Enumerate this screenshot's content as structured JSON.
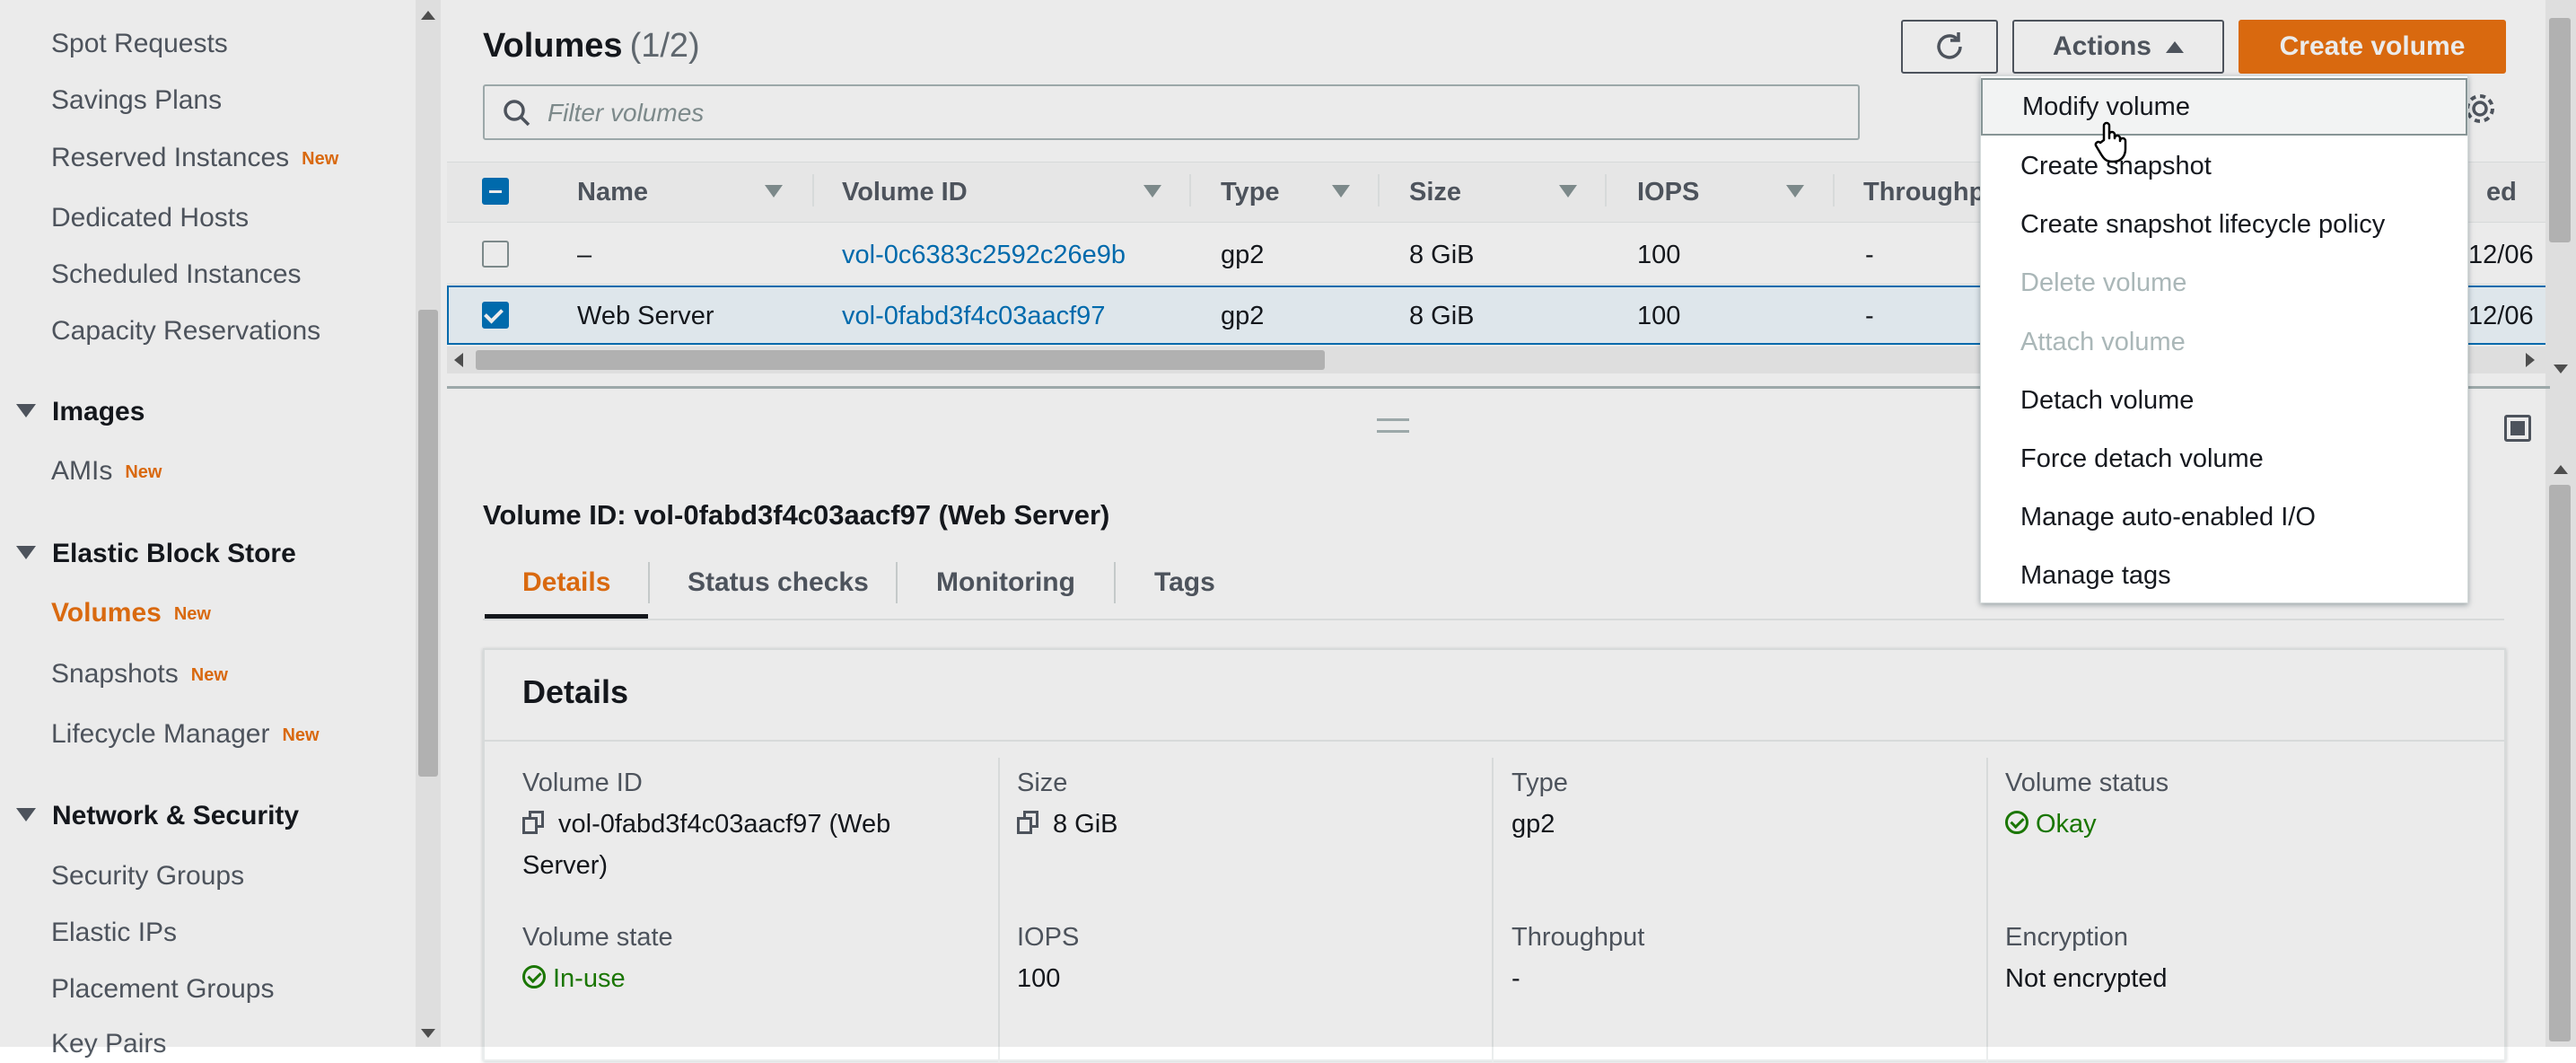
{
  "sidebar": {
    "items": [
      {
        "label": "Spot Requests",
        "badge": ""
      },
      {
        "label": "Savings Plans",
        "badge": ""
      },
      {
        "label": "Reserved Instances",
        "badge": "New"
      },
      {
        "label": "Dedicated Hosts",
        "badge": ""
      },
      {
        "label": "Scheduled Instances",
        "badge": ""
      },
      {
        "label": "Capacity Reservations",
        "badge": ""
      }
    ],
    "sections": {
      "images": {
        "title": "Images",
        "items": [
          {
            "label": "AMIs",
            "badge": "New"
          }
        ]
      },
      "ebs": {
        "title": "Elastic Block Store",
        "items": [
          {
            "label": "Volumes",
            "badge": "New"
          },
          {
            "label": "Snapshots",
            "badge": "New"
          },
          {
            "label": "Lifecycle Manager",
            "badge": "New"
          }
        ]
      },
      "network": {
        "title": "Network & Security",
        "items": [
          {
            "label": "Security Groups"
          },
          {
            "label": "Elastic IPs"
          },
          {
            "label": "Placement Groups"
          },
          {
            "label": "Key Pairs"
          }
        ]
      }
    }
  },
  "header": {
    "title": "Volumes",
    "count": "(1/2)",
    "actions_label": "Actions",
    "create_label": "Create volume",
    "refresh_icon": "refresh-icon"
  },
  "search": {
    "placeholder": "Filter volumes"
  },
  "table": {
    "columns": [
      "Name",
      "Volume ID",
      "Type",
      "Size",
      "IOPS",
      "Throughp",
      "ed"
    ],
    "rows": [
      {
        "name": "–",
        "volume_id": "vol-0c6383c2592c26e9b",
        "type": "gp2",
        "size": "8 GiB",
        "iops": "100",
        "throughput": "-",
        "created": "12/06",
        "selected": false
      },
      {
        "name": "Web Server",
        "volume_id": "vol-0fabd3f4c03aacf97",
        "type": "gp2",
        "size": "8 GiB",
        "iops": "100",
        "throughput": "-",
        "created": "12/06",
        "selected": true
      }
    ]
  },
  "actions_menu": {
    "items": [
      {
        "label": "Modify volume",
        "disabled": false
      },
      {
        "label": "Create snapshot",
        "disabled": false
      },
      {
        "label": "Create snapshot lifecycle policy",
        "disabled": false
      },
      {
        "label": "Delete volume",
        "disabled": true
      },
      {
        "label": "Attach volume",
        "disabled": true
      },
      {
        "label": "Detach volume",
        "disabled": false
      },
      {
        "label": "Force detach volume",
        "disabled": false
      },
      {
        "label": "Manage auto-enabled I/O",
        "disabled": false
      },
      {
        "label": "Manage tags",
        "disabled": false
      }
    ]
  },
  "detail": {
    "title": "Volume ID: vol-0fabd3f4c03aacf97 (Web Server)",
    "tabs": [
      "Details",
      "Status checks",
      "Monitoring",
      "Tags"
    ],
    "card_title": "Details",
    "fields": {
      "volume_id_label": "Volume ID",
      "volume_id_value_line1": "vol-0fabd3f4c03aacf97 (Web",
      "volume_id_value_line2": "Server)",
      "size_label": "Size",
      "size_value": "8 GiB",
      "type_label": "Type",
      "type_value": "gp2",
      "status_label": "Volume status",
      "status_value": "Okay",
      "state_label": "Volume state",
      "state_value": "In-use",
      "iops_label": "IOPS",
      "iops_value": "100",
      "throughput_label": "Throughput",
      "throughput_value": "-",
      "encryption_label": "Encryption",
      "encryption_value": "Not encrypted"
    }
  },
  "colors": {
    "accent": "#ec7211",
    "link": "#0073bb",
    "success": "#1d8102"
  }
}
